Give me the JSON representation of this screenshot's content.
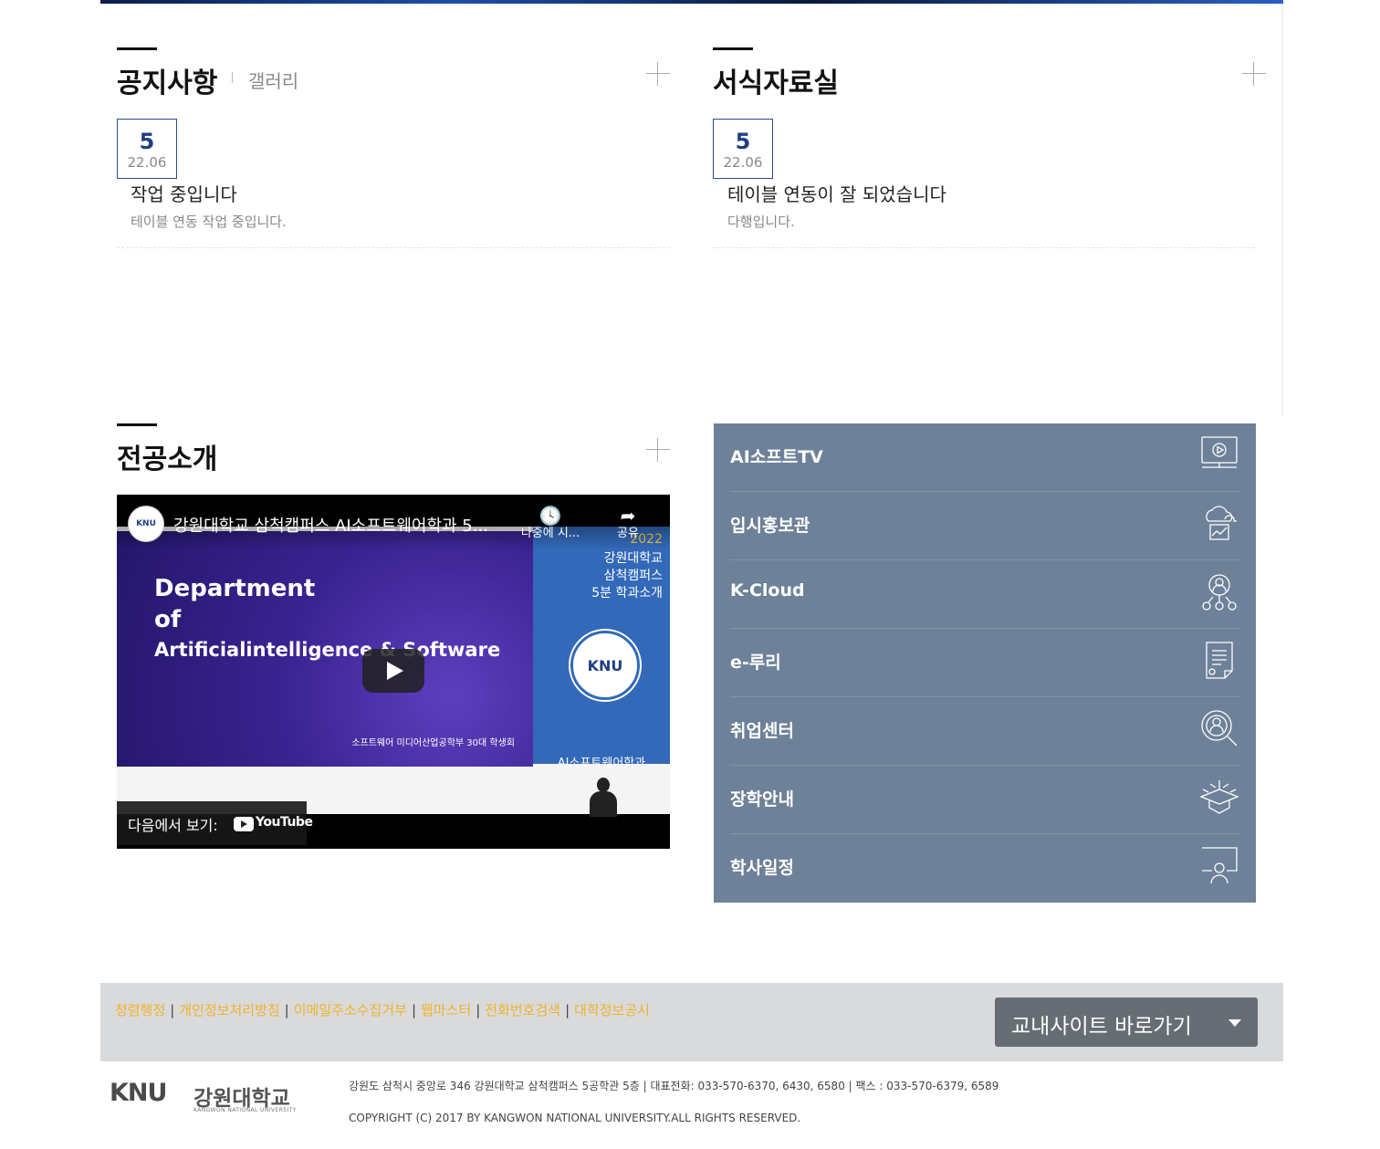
{
  "notice_board": {
    "title": "공지사항",
    "tab_gallery": "갤러리",
    "post": {
      "day": "5",
      "year_month": "22.06",
      "title": "작업 중입니다",
      "description": "테이블 연동 작업 중입니다."
    }
  },
  "forms_board": {
    "title": "서식자료실",
    "post": {
      "day": "5",
      "year_month": "22.06",
      "title": "테이블 연동이 잘 되었습니다",
      "description": "다행입니다."
    }
  },
  "major_intro": {
    "title": "전공소개",
    "video": {
      "title": "강원대학교 삼척캠퍼스 AI소프트웨어학과 5...",
      "channel_badge": "KNU",
      "watch_later": "나중에 시...",
      "share": "공유",
      "slide_line1": "Department",
      "slide_line2": "of",
      "slide_line3": "Artificialintelligence & Software",
      "slide_credit": "소프트웨어 미디어산업공학부 30대 학생회",
      "side_year": "2022",
      "side_intro": [
        "강원대학교",
        "삼척캠퍼스",
        "5분 학과소개"
      ],
      "side_logo": "KNU",
      "side_dept": "AI소프트웨어학과",
      "watch_on": "다음에서 보기:",
      "youtube": "YouTube"
    }
  },
  "quick_links": [
    {
      "label": "AI소프트TV",
      "icon": "monitor-play-icon"
    },
    {
      "label": "입시홍보관",
      "icon": "cloud-chart-icon"
    },
    {
      "label": "K-Cloud",
      "icon": "network-person-icon"
    },
    {
      "label": "e-루리",
      "icon": "document-icon"
    },
    {
      "label": "취업센터",
      "icon": "search-person-icon"
    },
    {
      "label": "장학안내",
      "icon": "graduation-cap-icon"
    },
    {
      "label": "학사일정",
      "icon": "presentation-icon"
    }
  ],
  "footer": {
    "links": [
      "청렴행정",
      "개인정보처리방침",
      "이메일주소수집거부",
      "웹마스터",
      "전화번호검색",
      "대학정보공시"
    ],
    "site_button": "교내사이트 바로가기",
    "logo_mark": "KNU",
    "logo_name": "강원대학교",
    "logo_english": "KANGWON NATIONAL UNIVERSITY",
    "address": "강원도 삼척시 중앙로 346 강원대학교 삼척캠퍼스 5공학관 5층 | 대표전화: 033-570-6370, 6430, 6580 | 팩스 : 033-570-6379, 6589",
    "copyright": "COPYRIGHT (C) 2017 BY KANGWON NATIONAL UNIVERSITY.ALL RIGHTS RESERVED."
  },
  "colors": {
    "quick_panel_bg": "#6d8199",
    "date_accent": "#1f3f82",
    "footer_link": "#f0b42a",
    "footer_bar_bg": "#d9dadc",
    "site_button_bg": "#676d74"
  }
}
